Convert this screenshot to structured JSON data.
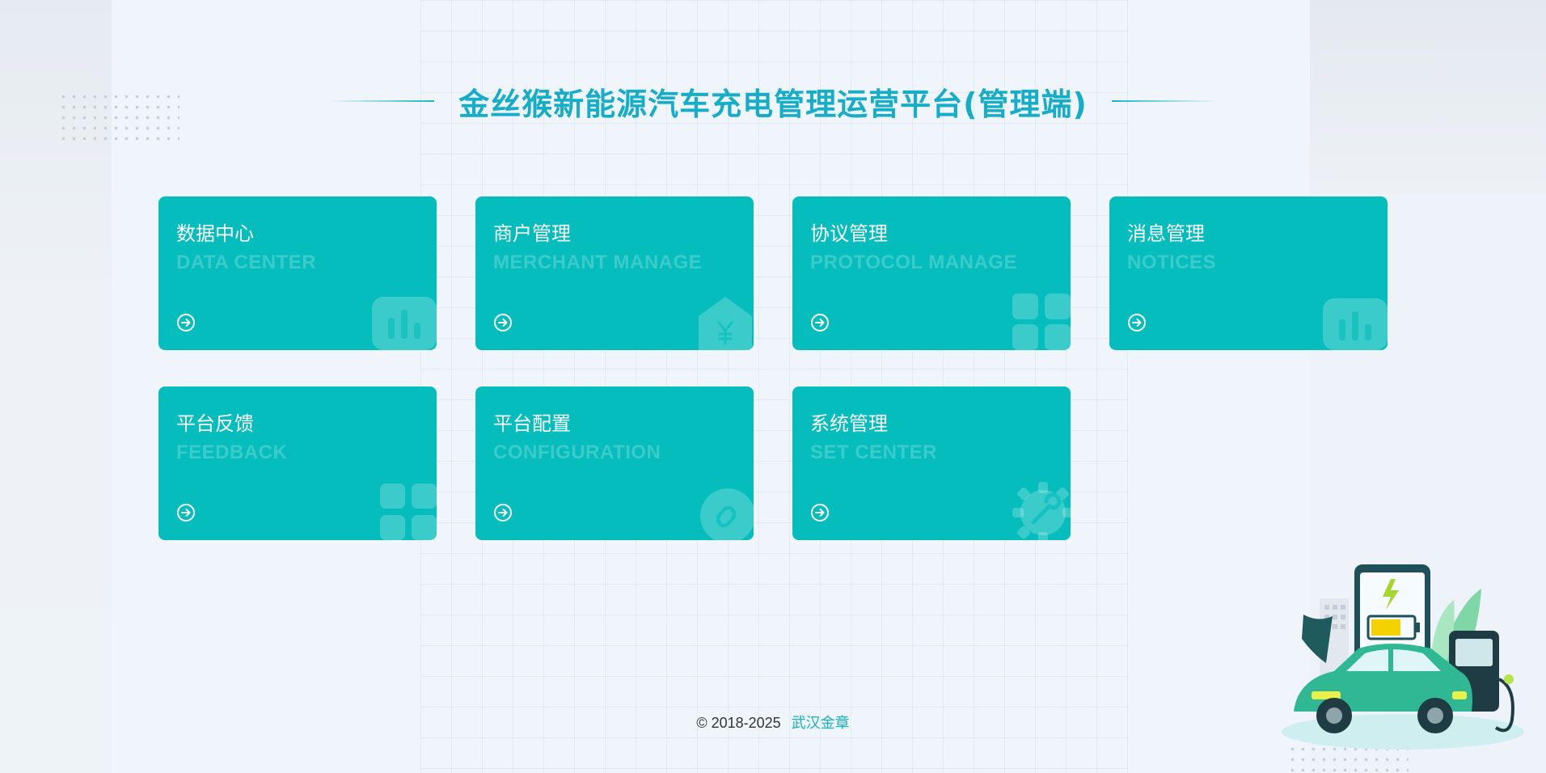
{
  "header": {
    "title": "金丝猴新能源汽车充电管理运营平台(管理端)"
  },
  "cards": [
    {
      "title": "数据中心",
      "subtitle": "DATA CENTER",
      "icon": "bar-chart-icon"
    },
    {
      "title": "商户管理",
      "subtitle": "MERCHANT MANAGE",
      "icon": "yuan-house-icon"
    },
    {
      "title": "协议管理",
      "subtitle": "PROTOCOL MANAGE",
      "icon": "grid-apps-icon"
    },
    {
      "title": "消息管理",
      "subtitle": "NOTICES",
      "icon": "bar-chart-icon"
    },
    {
      "title": "平台反馈",
      "subtitle": "FEEDBACK",
      "icon": "grid-apps-icon"
    },
    {
      "title": "平台配置",
      "subtitle": "CONFIGURATION",
      "icon": "link-icon"
    },
    {
      "title": "系统管理",
      "subtitle": "SET CENTER",
      "icon": "gear-wrench-icon"
    }
  ],
  "footer": {
    "copyright": "© 2018-2025",
    "company": "武汉金章"
  },
  "colors": {
    "card": "#05bdbd",
    "accent": "#15adc8",
    "background": "#f0f5fb"
  }
}
